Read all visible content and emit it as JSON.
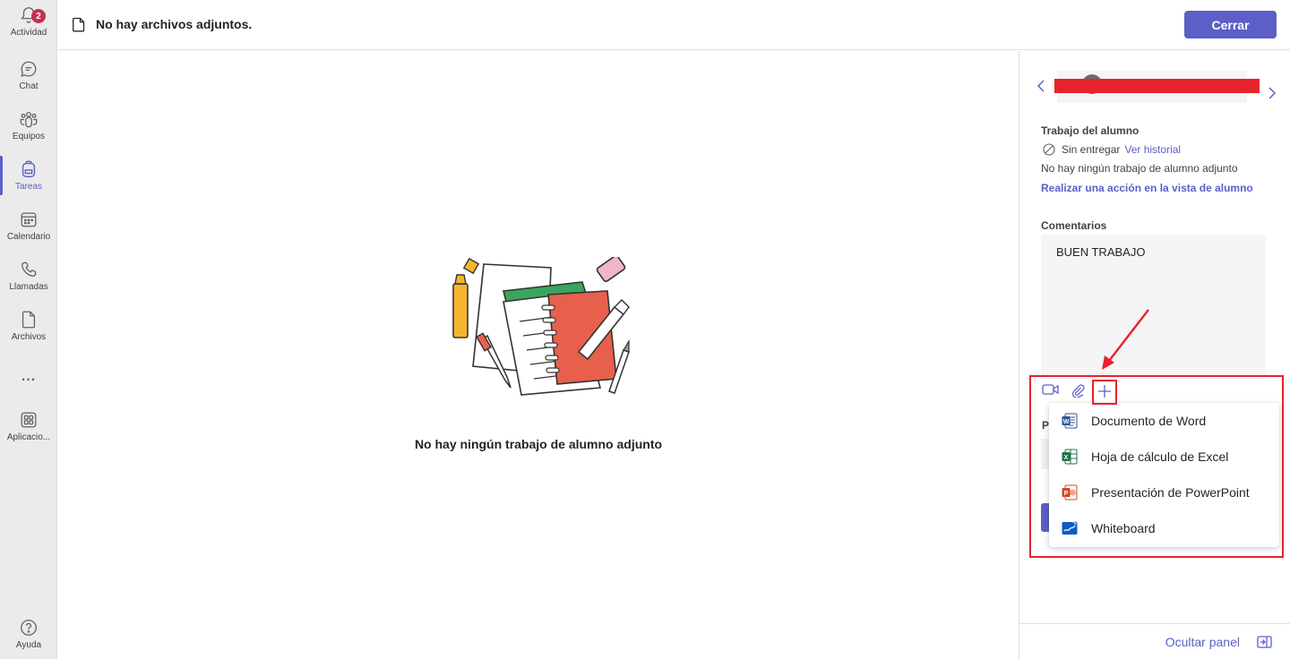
{
  "rail": {
    "items": [
      {
        "label": "Actividad",
        "icon": "bell-icon",
        "badge": "2"
      },
      {
        "label": "Chat",
        "icon": "chat-icon"
      },
      {
        "label": "Equipos",
        "icon": "teams-icon"
      },
      {
        "label": "Tareas",
        "icon": "backpack-icon",
        "active": true
      },
      {
        "label": "Calendario",
        "icon": "calendar-icon"
      },
      {
        "label": "Llamadas",
        "icon": "phone-icon"
      },
      {
        "label": "Archivos",
        "icon": "file-icon"
      },
      {
        "label": "...",
        "icon": "more-icon"
      },
      {
        "label": "Aplicacio...",
        "icon": "apps-icon"
      }
    ],
    "help_label": "Ayuda"
  },
  "header": {
    "title": "No hay archivos adjuntos.",
    "close_label": "Cerrar"
  },
  "main": {
    "empty_text": "No hay ningún trabajo de alumno adjunto"
  },
  "panel": {
    "student_work_label": "Trabajo del alumno",
    "status_text": "Sin entregar",
    "history_link": "Ver historial",
    "no_work_text": "No hay ningún trabajo de alumno adjunto",
    "action_link": "Realizar una acción en la vista de alumno",
    "comments_label": "Comentarios",
    "comment_text": "BUEN TRABAJO",
    "points_label_partial": "P",
    "hide_panel_label": "Ocultar panel"
  },
  "menu": {
    "items": [
      {
        "label": "Documento de Word",
        "icon": "word-icon",
        "color": "#2b579a"
      },
      {
        "label": "Hoja de cálculo de Excel",
        "icon": "excel-icon",
        "color": "#217346"
      },
      {
        "label": "Presentación de PowerPoint",
        "icon": "powerpoint-icon",
        "color": "#d24726"
      },
      {
        "label": "Whiteboard",
        "icon": "whiteboard-icon",
        "color": "#0f5cc0"
      }
    ]
  },
  "colors": {
    "accent": "#5b5fc7",
    "annotation": "#e8222d",
    "badge": "#c4314b"
  }
}
